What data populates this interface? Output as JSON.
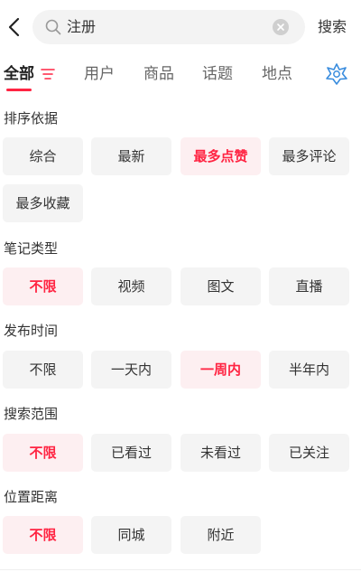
{
  "header": {
    "query": "注册",
    "search_label": "搜索"
  },
  "tabs": [
    {
      "label": "全部",
      "active": true
    },
    {
      "label": "用户",
      "active": false
    },
    {
      "label": "商品",
      "active": false
    },
    {
      "label": "话题",
      "active": false
    },
    {
      "label": "地点",
      "active": false
    }
  ],
  "colors": {
    "accent": "#ff2442",
    "selected_bg": "#fdeff1",
    "chip_bg": "#f4f4f4"
  },
  "sections": [
    {
      "title": "排序依据",
      "options": [
        "综合",
        "最新",
        "最多点赞",
        "最多评论",
        "最多收藏"
      ],
      "selected": "最多点赞"
    },
    {
      "title": "笔记类型",
      "options": [
        "不限",
        "视频",
        "图文",
        "直播"
      ],
      "selected": "不限"
    },
    {
      "title": "发布时间",
      "options": [
        "不限",
        "一天内",
        "一周内",
        "半年内"
      ],
      "selected": "一周内"
    },
    {
      "title": "搜索范围",
      "options": [
        "不限",
        "已看过",
        "未看过",
        "已关注"
      ],
      "selected": "不限"
    },
    {
      "title": "位置距离",
      "options": [
        "不限",
        "同城",
        "附近"
      ],
      "selected": "不限"
    }
  ]
}
